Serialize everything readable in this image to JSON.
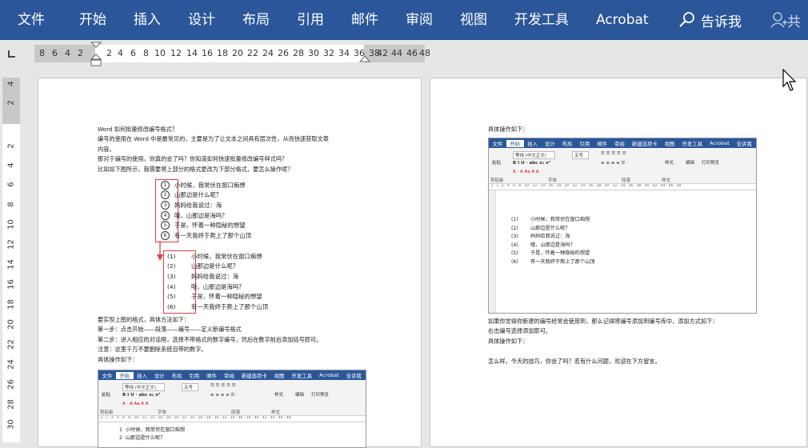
{
  "ribbon": {
    "tabs": [
      "文件",
      "开始",
      "插入",
      "设计",
      "布局",
      "引用",
      "邮件",
      "审阅",
      "视图",
      "开发工具",
      "Acrobat"
    ],
    "tell_me": "告诉我",
    "share": "共"
  },
  "hruler": {
    "numbers": [
      "8",
      "6",
      "4",
      "2",
      "2",
      "4",
      "6",
      "8",
      "10",
      "12",
      "14",
      "16",
      "18",
      "20",
      "22",
      "24",
      "26",
      "28",
      "30",
      "32",
      "34",
      "36",
      "38",
      "42",
      "44",
      "46",
      "48"
    ]
  },
  "vruler": {
    "numbers": [
      "4",
      "2",
      "2",
      "4",
      "6",
      "8",
      "10",
      "12",
      "14",
      "16",
      "18",
      "20",
      "22",
      "24",
      "26",
      "28",
      "30"
    ]
  },
  "page1": {
    "intro": [
      "Word 如何批量修改编号格式？",
      "编号的使用在 Word 中是最常见的，主要是为了让文本之间具有层次性，从而快速获取文章",
      "内容。",
      "那对于编号的使用，你真的会了吗？你知道如何快速批量修改编号样式吗？",
      "比如如下图所示，我需要将上部分的格式更改为下部分格式，要怎么操作呢？"
    ],
    "list_circled": [
      {
        "num": "1",
        "text": "小时候，我常伏在窗口痴想"
      },
      {
        "num": "2",
        "text": "山那边是什么呢？"
      },
      {
        "num": "3",
        "text": "妈妈给我说过：海"
      },
      {
        "num": "4",
        "text": "哦，山那边是海吗？"
      },
      {
        "num": "5",
        "text": "于是，怀着一种隐秘的想望"
      },
      {
        "num": "6",
        "text": "有一天我终于爬上了那个山顶"
      }
    ],
    "list_paren": [
      {
        "num": "(1)",
        "text": "小时候，我常伏在窗口痴想"
      },
      {
        "num": "(2)",
        "text": "山那边是什么呢？"
      },
      {
        "num": "(3)",
        "text": "妈妈给我说过：海"
      },
      {
        "num": "(4)",
        "text": "哦，山那边是海吗？"
      },
      {
        "num": "(5)",
        "text": "于是，怀着一种隐秘的想望"
      },
      {
        "num": "(6)",
        "text": "有一天我终于爬上了那个山顶"
      }
    ],
    "steps": [
      "要实现上图的格式，具体方法如下：",
      "第一步：点击开始——段落——编号——定义新编号格式",
      "第二步：进入相应的对话框，选择不带格式的数字编号，然后在数字前后添加括号即可。",
      "注意：这里千万不要删除系统自带的数字。",
      "具体操作如下："
    ]
  },
  "page2": {
    "top_label": "具体操作如下：",
    "after": [
      "如果你觉得你新建的编号经常会使用到，那么记得将编号添加到编号库中，添加方式如下：",
      "右击编号选择添加即可。",
      "具体操作如下：",
      "",
      "怎么样，今天的技巧，你会了吗？若有什么问题，欢迎在下方留言。"
    ]
  },
  "shot": {
    "tabs": [
      "文件",
      "开始",
      "插入",
      "设计",
      "布局",
      "引用",
      "邮件",
      "审阅",
      "新建选项卡",
      "视图",
      "开发工具",
      "Acrobat",
      "告诉我"
    ],
    "font_name": "等线 (中文正文)",
    "font_size": "五号",
    "paste": "粘贴",
    "styles": "样式",
    "edit": "编辑",
    "print_preview": "打印预览",
    "clipboard": "剪贴板",
    "font_group": "字体",
    "para_group": "段落",
    "style_group": "样式",
    "lines": [
      {
        "num": "(1)",
        "text": "小时候，我常伏在窗口痴想"
      },
      {
        "num": "(2)",
        "text": "山那边是什么呢？"
      },
      {
        "num": "(3)",
        "text": "妈妈给我说过：海"
      },
      {
        "num": "(4)",
        "text": "哦，山那边是海吗？"
      },
      {
        "num": "(5)",
        "text": "于是，怀着一种隐秘的想望"
      },
      {
        "num": "(6)",
        "text": "有一天我终于爬上了那个山顶"
      }
    ],
    "bottom_lines": [
      {
        "num": "1",
        "text": "小时候，我常伏在窗口痴想"
      },
      {
        "num": "2",
        "text": "山那边是什么呢？"
      }
    ]
  }
}
